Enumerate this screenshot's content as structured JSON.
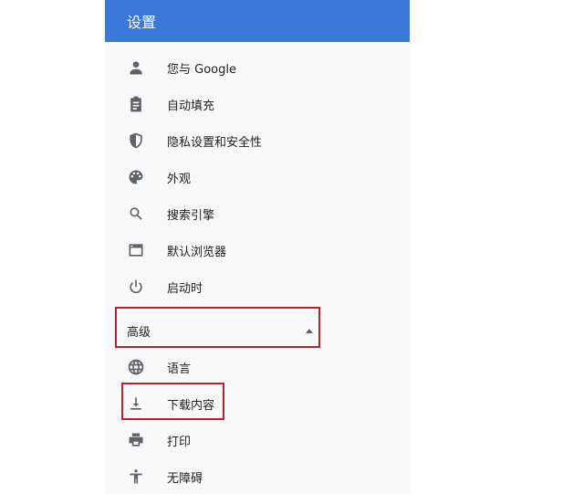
{
  "header": {
    "title": "设置"
  },
  "nav": {
    "items": [
      {
        "label": "您与 Google",
        "icon": "person-icon"
      },
      {
        "label": "自动填充",
        "icon": "clipboard-icon"
      },
      {
        "label": "隐私设置和安全性",
        "icon": "shield-icon"
      },
      {
        "label": "外观",
        "icon": "palette-icon"
      },
      {
        "label": "搜索引擎",
        "icon": "search-icon"
      },
      {
        "label": "默认浏览器",
        "icon": "browser-window-icon"
      },
      {
        "label": "启动时",
        "icon": "power-icon"
      }
    ],
    "advanced": {
      "label": "高级",
      "icon": "arrow-up-icon"
    },
    "advanced_items": [
      {
        "label": "语言",
        "icon": "globe-icon"
      },
      {
        "label": "下载内容",
        "icon": "download-icon"
      },
      {
        "label": "打印",
        "icon": "printer-icon"
      },
      {
        "label": "无障碍",
        "icon": "accessibility-icon"
      }
    ]
  },
  "colors": {
    "header_bg": "#3c78d8",
    "highlight": "#c0202a",
    "icon": "#5f6368"
  }
}
